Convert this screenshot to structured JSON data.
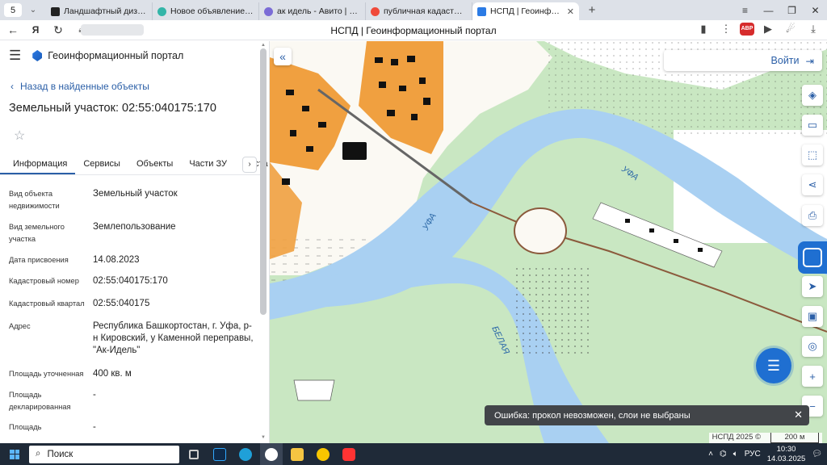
{
  "browser": {
    "tab_count": "5",
    "tabs": [
      {
        "label": "Ландшафтный дизайн | О",
        "favicon_color": "#222222"
      },
      {
        "label": "Новое объявление — Об",
        "favicon_color": "#33b5a8"
      },
      {
        "label": "ак идель - Авито | Объяв",
        "favicon_color": "#7b6cd6"
      },
      {
        "label": "публичная кадастровая",
        "favicon_color": "#f04a3a"
      },
      {
        "label": "НСПД | Геоинформаци",
        "favicon_color": "#2b7be5"
      }
    ],
    "window_title": "НСПД | Геоинформационный портал",
    "adblock_label": "ABP"
  },
  "sidebar": {
    "portal_title": "Геоинформационный портал",
    "back_link": "Назад в найденные объекты",
    "object_title": "Земельный участок: 02:55:040175:170",
    "tabs": [
      "Информация",
      "Сервисы",
      "Объекты",
      "Части ЗУ",
      "Соста"
    ],
    "properties": [
      {
        "key": "Вид объекта недвижимости",
        "value": "Земельный участок"
      },
      {
        "key": "Вид земельного участка",
        "value": "Землепользование"
      },
      {
        "key": "Дата присвоения",
        "value": "14.08.2023"
      },
      {
        "key": "Кадастровый номер",
        "value": "02:55:040175:170"
      },
      {
        "key": "Кадастровый квартал",
        "value": "02:55:040175"
      },
      {
        "key": "Адрес",
        "value": "Республика Башкортостан, г. Уфа, р-н Кировский, у Каменной переправы, \"Ак-Идель\""
      },
      {
        "key": "Площадь уточненная",
        "value": "400 кв. м"
      },
      {
        "key": "Площадь декларированная",
        "value": "-"
      },
      {
        "key": "Площадь",
        "value": "-"
      }
    ]
  },
  "map": {
    "login_label": "Войти",
    "river_labels": [
      "УФА",
      "УФА",
      "БЕЛАЯ"
    ],
    "error_toast": "Ошибка: прокол невозможен, слои не выбраны",
    "attribution": "НСПД 2025 ©",
    "scale_label": "200 м"
  },
  "taskbar": {
    "search_placeholder": "Поиск",
    "language": "РУС",
    "time": "10:30",
    "date": "14.03.2025"
  }
}
